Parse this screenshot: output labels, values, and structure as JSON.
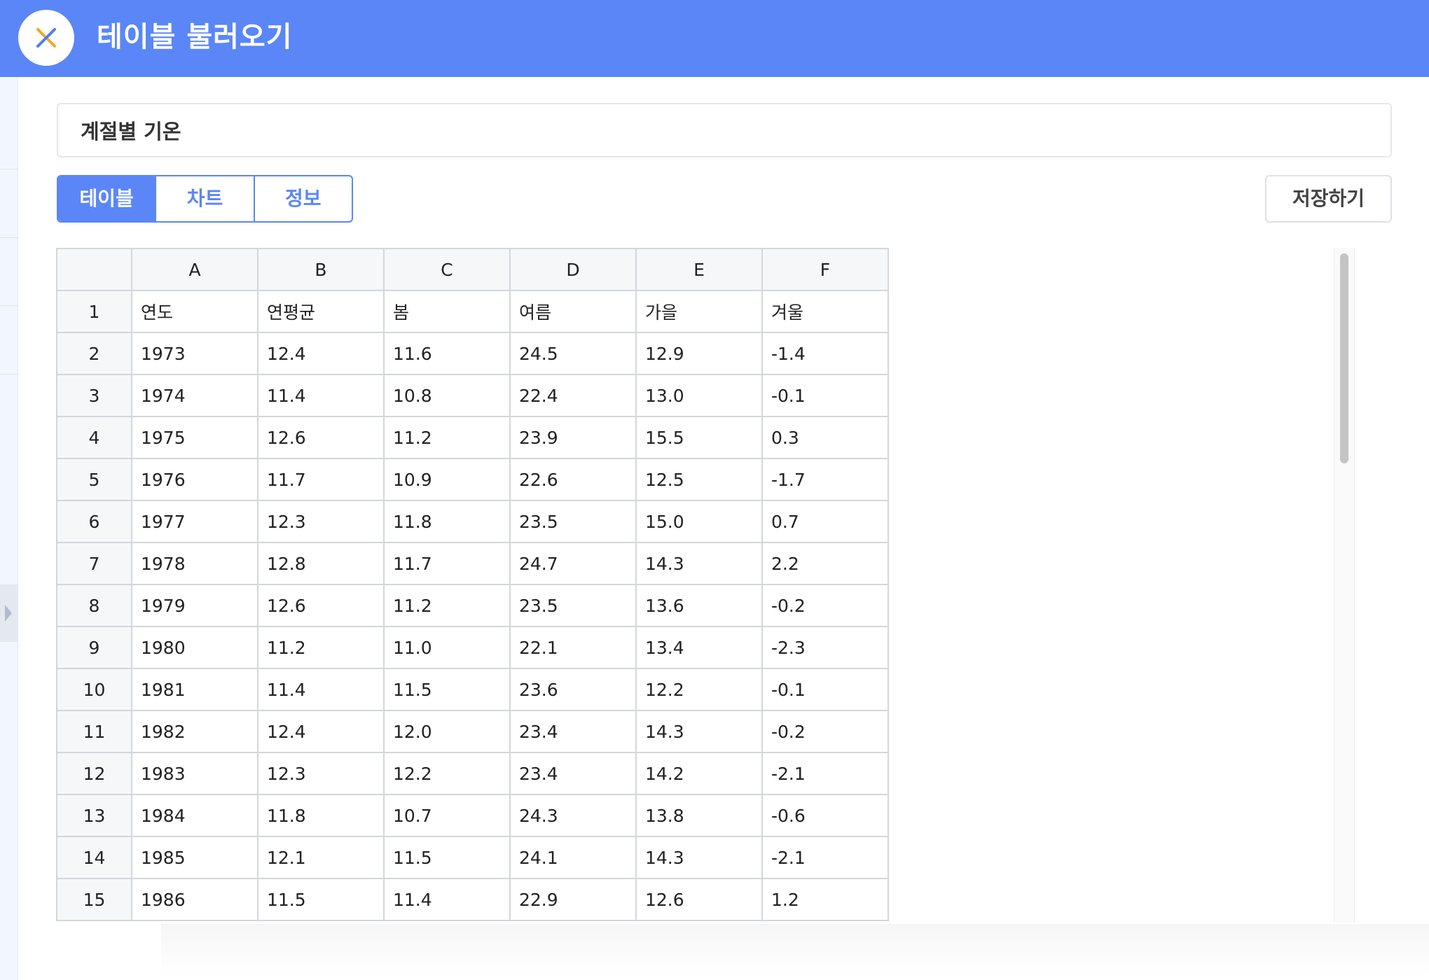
{
  "header": {
    "title": "테이블 불러오기",
    "close_icon": "close-x-icon",
    "accent_color": "#5a86f8"
  },
  "name_input": {
    "value": "계절별 기온"
  },
  "tabs": [
    {
      "label": "테이블",
      "active": true
    },
    {
      "label": "차트",
      "active": false
    },
    {
      "label": "정보",
      "active": false
    }
  ],
  "save_button": {
    "label": "저장하기"
  },
  "grid": {
    "column_headers": [
      "A",
      "B",
      "C",
      "D",
      "E",
      "F"
    ],
    "rows": [
      {
        "num": "1",
        "cells": [
          "연도",
          "연평균",
          "봄",
          "여름",
          "가을",
          "겨울"
        ]
      },
      {
        "num": "2",
        "cells": [
          "1973",
          "12.4",
          "11.6",
          "24.5",
          "12.9",
          "-1.4"
        ]
      },
      {
        "num": "3",
        "cells": [
          "1974",
          "11.4",
          "10.8",
          "22.4",
          "13.0",
          "-0.1"
        ]
      },
      {
        "num": "4",
        "cells": [
          "1975",
          "12.6",
          "11.2",
          "23.9",
          "15.5",
          "0.3"
        ]
      },
      {
        "num": "5",
        "cells": [
          "1976",
          "11.7",
          "10.9",
          "22.6",
          "12.5",
          "-1.7"
        ]
      },
      {
        "num": "6",
        "cells": [
          "1977",
          "12.3",
          "11.8",
          "23.5",
          "15.0",
          "0.7"
        ]
      },
      {
        "num": "7",
        "cells": [
          "1978",
          "12.8",
          "11.7",
          "24.7",
          "14.3",
          "2.2"
        ]
      },
      {
        "num": "8",
        "cells": [
          "1979",
          "12.6",
          "11.2",
          "23.5",
          "13.6",
          "-0.2"
        ]
      },
      {
        "num": "9",
        "cells": [
          "1980",
          "11.2",
          "11.0",
          "22.1",
          "13.4",
          "-2.3"
        ]
      },
      {
        "num": "10",
        "cells": [
          "1981",
          "11.4",
          "11.5",
          "23.6",
          "12.2",
          "-0.1"
        ]
      },
      {
        "num": "11",
        "cells": [
          "1982",
          "12.4",
          "12.0",
          "23.4",
          "14.3",
          "-0.2"
        ]
      },
      {
        "num": "12",
        "cells": [
          "1983",
          "12.3",
          "12.2",
          "23.4",
          "14.2",
          "-2.1"
        ]
      },
      {
        "num": "13",
        "cells": [
          "1984",
          "11.8",
          "10.7",
          "24.3",
          "13.8",
          "-0.6"
        ]
      },
      {
        "num": "14",
        "cells": [
          "1985",
          "12.1",
          "11.5",
          "24.1",
          "14.3",
          "-2.1"
        ]
      },
      {
        "num": "15",
        "cells": [
          "1986",
          "11.5",
          "11.4",
          "22.9",
          "12.6",
          "1.2"
        ]
      }
    ]
  }
}
